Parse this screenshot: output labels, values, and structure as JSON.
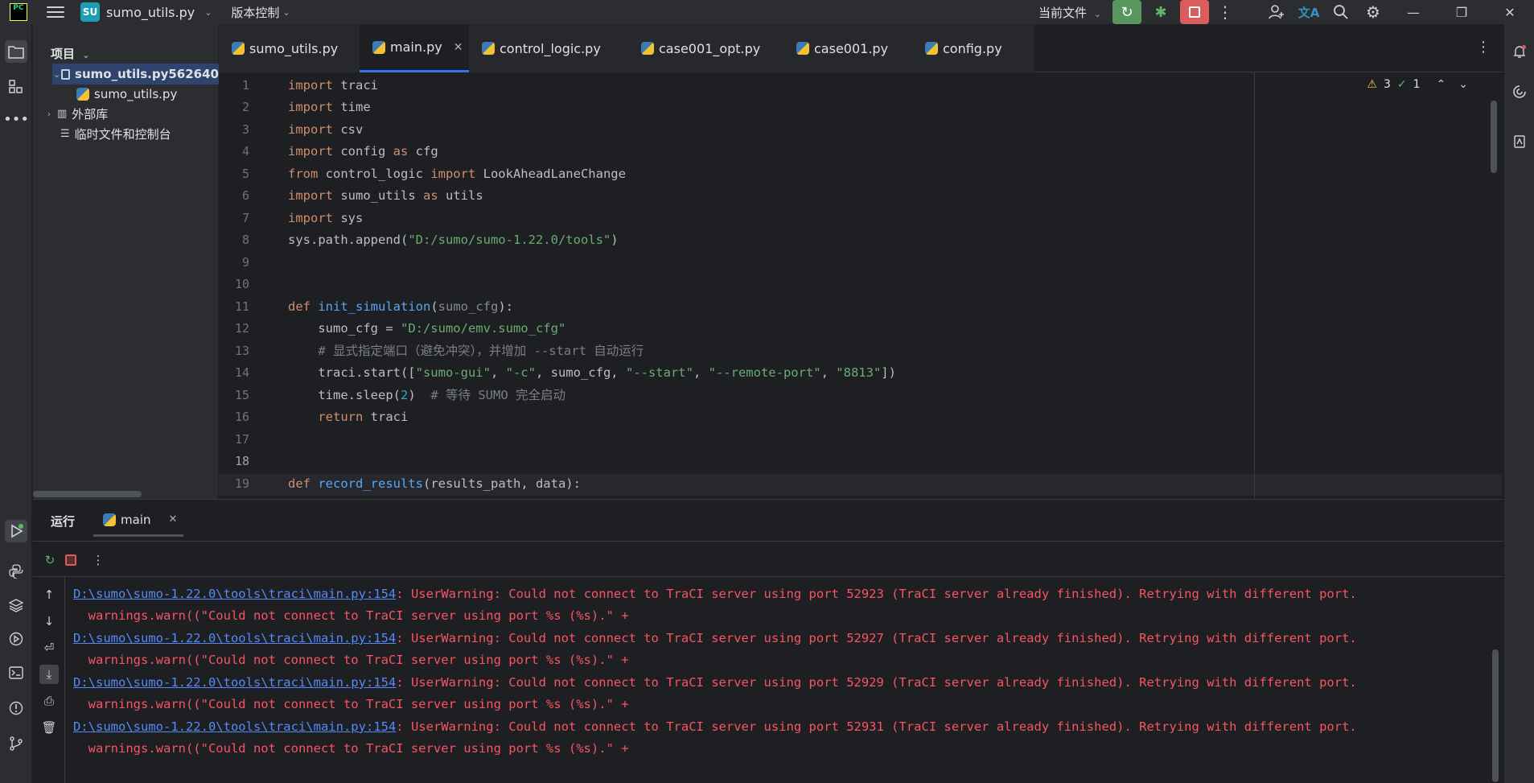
{
  "titlebar": {
    "logo": "PC",
    "project_badge": "SU",
    "project_name": "sumo_utils.py",
    "vcs_label": "版本控制",
    "run_config": "当前文件"
  },
  "project_panel": {
    "title": "项目",
    "root": "sumo_utils.py562640",
    "child_file": "sumo_utils.py",
    "external_libs": "外部库",
    "scratches": "临时文件和控制台"
  },
  "editor": {
    "tabs": [
      {
        "label": "sumo_utils.py"
      },
      {
        "label": "main.py"
      },
      {
        "label": "control_logic.py"
      },
      {
        "label": "case001_opt.py"
      },
      {
        "label": "case001.py"
      },
      {
        "label": "config.py"
      }
    ],
    "inspection": {
      "warnings": "3",
      "ok": "1"
    },
    "line_numbers": [
      "1",
      "2",
      "3",
      "4",
      "5",
      "6",
      "7",
      "8",
      "9",
      "10",
      "11",
      "12",
      "13",
      "14",
      "15",
      "16",
      "17",
      "18",
      "19"
    ],
    "code": {
      "l1_kw": "import",
      "l1_rest": " traci",
      "l2_kw": "import",
      "l2_rest": " time",
      "l3_kw": "import",
      "l3_rest": " csv",
      "l4_kw": "import",
      "l4_mid": " config ",
      "l4_kw2": "as",
      "l4_rest": " cfg",
      "l5_kw": "from",
      "l5_mid": " control_logic ",
      "l5_kw2": "import",
      "l5_rest": " LookAheadLaneChange",
      "l6_kw": "import",
      "l6_mid": " sumo_utils ",
      "l6_kw2": "as",
      "l6_rest": " utils",
      "l7_kw": "import",
      "l7_rest": " sys",
      "l8_pre": "sys.path.append(",
      "l8_str": "\"D:/sumo/sumo-1.22.0/tools\"",
      "l8_post": ")",
      "l11_kw": "def",
      "l11_fn": "init_simulation",
      "l11_open": "(",
      "l11_param": "sumo_cfg",
      "l11_close": "):",
      "l12_pre": "    sumo_cfg = ",
      "l12_str": "\"D:/sumo/emv.sumo_cfg\"",
      "l13_comment": "    # 显式指定端口（避免冲突），并增加 --start 自动运行",
      "l14_pre": "    traci.start([",
      "l14_s1": "\"sumo-gui\"",
      "l14_c1": ", ",
      "l14_s2": "\"-c\"",
      "l14_c2": ", sumo_cfg, ",
      "l14_s3": "\"--start\"",
      "l14_c3": ", ",
      "l14_s4": "\"--remote-port\"",
      "l14_c4": ", ",
      "l14_s5": "\"8813\"",
      "l14_post": "])",
      "l15_pre": "    time.sleep(",
      "l15_num": "2",
      "l15_post": ")  ",
      "l15_comment": "# 等待 SUMO 完全启动",
      "l16_kw": "    return",
      "l16_rest": " traci",
      "l19_kw": "def",
      "l19_fn": "record_results",
      "l19_rest": "(results_path, data):"
    }
  },
  "run_panel": {
    "title": "运行",
    "tab_label": "main",
    "output": [
      {
        "link": "D:\\sumo\\sumo-1.22.0\\tools\\traci\\main.py:154",
        "msg": ": UserWarning: Could not connect to TraCI server using port 52923 (TraCI server already finished). Retrying with different port."
      },
      {
        "text": "  warnings.warn((\"Could not connect to TraCI server using port %s (%s).\" +"
      },
      {
        "link": "D:\\sumo\\sumo-1.22.0\\tools\\traci\\main.py:154",
        "msg": ": UserWarning: Could not connect to TraCI server using port 52927 (TraCI server already finished). Retrying with different port."
      },
      {
        "text": "  warnings.warn((\"Could not connect to TraCI server using port %s (%s).\" +"
      },
      {
        "link": "D:\\sumo\\sumo-1.22.0\\tools\\traci\\main.py:154",
        "msg": ": UserWarning: Could not connect to TraCI server using port 52929 (TraCI server already finished). Retrying with different port."
      },
      {
        "text": "  warnings.warn((\"Could not connect to TraCI server using port %s (%s).\" +"
      },
      {
        "link": "D:\\sumo\\sumo-1.22.0\\tools\\traci\\main.py:154",
        "msg": ": UserWarning: Could not connect to TraCI server using port 52931 (TraCI server already finished). Retrying with different port."
      },
      {
        "text": "  warnings.warn((\"Could not connect to TraCI server using port %s (%s).\" +"
      }
    ]
  },
  "icons": {
    "hamburger": "menu-icon",
    "run": "▶",
    "debug": "✱",
    "more": "⋮",
    "add_user": "⊕",
    "translate": "文A",
    "search": "⌕",
    "settings": "⚙",
    "minimize": "—",
    "maximize": "❐",
    "close": "✕",
    "chev_down": "⌄",
    "chev_right": "›"
  },
  "colors": {
    "accent": "#3574f0",
    "run_green": "#57965c",
    "stop_red": "#db5c5c",
    "error_text": "#f75464",
    "link": "#548af7"
  }
}
